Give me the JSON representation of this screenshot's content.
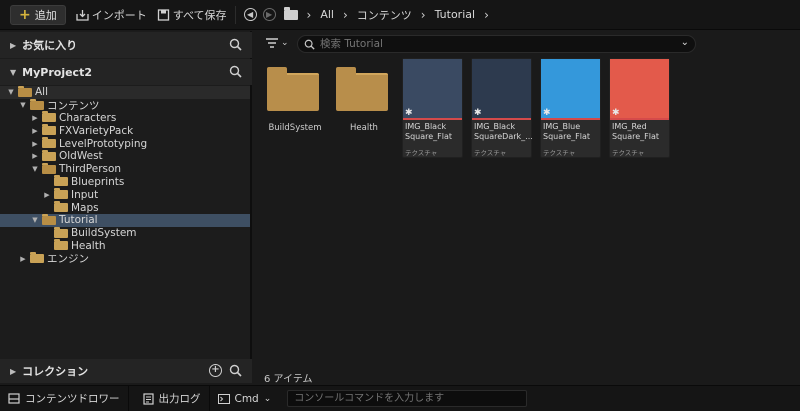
{
  "toolbar": {
    "add_label": "追加",
    "import_label": "インポート",
    "save_all_label": "すべて保存",
    "breadcrumb": [
      "All",
      "コンテンツ",
      "Tutorial"
    ]
  },
  "sources": {
    "favorites_label": "お気に入り",
    "project_label": "MyProject2",
    "tree": [
      {
        "label": "All",
        "indent": 0,
        "open": true,
        "arrow": "down"
      },
      {
        "label": "コンテンツ",
        "indent": 1,
        "open": true,
        "arrow": "down"
      },
      {
        "label": "Characters",
        "indent": 2,
        "open": false,
        "arrow": "right"
      },
      {
        "label": "FXVarietyPack",
        "indent": 2,
        "open": false,
        "arrow": "right"
      },
      {
        "label": "LevelPrototyping",
        "indent": 2,
        "open": false,
        "arrow": "right"
      },
      {
        "label": "OldWest",
        "indent": 2,
        "open": false,
        "arrow": "right"
      },
      {
        "label": "ThirdPerson",
        "indent": 2,
        "open": true,
        "arrow": "down"
      },
      {
        "label": "Blueprints",
        "indent": 3,
        "open": false,
        "arrow": ""
      },
      {
        "label": "Input",
        "indent": 3,
        "open": false,
        "arrow": "right"
      },
      {
        "label": "Maps",
        "indent": 3,
        "open": false,
        "arrow": ""
      },
      {
        "label": "Tutorial",
        "indent": 2,
        "open": true,
        "arrow": "down",
        "selected": true
      },
      {
        "label": "BuildSystem",
        "indent": 3,
        "open": false,
        "arrow": ""
      },
      {
        "label": "Health",
        "indent": 3,
        "open": false,
        "arrow": ""
      },
      {
        "label": "エンジン",
        "indent": 1,
        "open": false,
        "arrow": "right"
      }
    ],
    "collections_label": "コレクション"
  },
  "content": {
    "search_placeholder": "検索 Tutorial",
    "folders": [
      {
        "label": "BuildSystem"
      },
      {
        "label": "Health"
      }
    ],
    "textures": [
      {
        "name": "IMG_Black Square_Flat",
        "kind": "テクスチャ",
        "color": "#3a4a62"
      },
      {
        "name": "IMG_Black SquareDark_...",
        "kind": "テクスチャ",
        "color": "#2d3a4e"
      },
      {
        "name": "IMG_Blue Square_Flat",
        "kind": "テクスチャ",
        "color": "#3498db"
      },
      {
        "name": "IMG_Red Square_Flat",
        "kind": "テクスチャ",
        "color": "#e35a4b"
      }
    ],
    "item_count": "6 アイテム"
  },
  "bottom": {
    "drawer_label": "コンテンツドロワー",
    "output_log_label": "出力ログ",
    "cmd_label": "Cmd",
    "cmd_placeholder": "コンソールコマンドを入力します"
  }
}
